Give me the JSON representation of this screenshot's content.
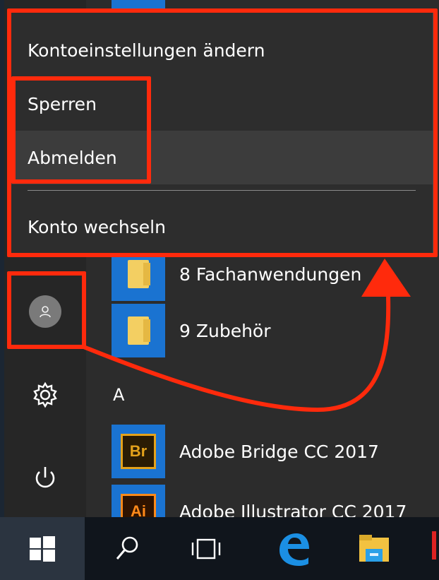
{
  "account_menu": {
    "items": [
      {
        "label": "Kontoeinstellungen ändern"
      },
      {
        "label": "Sperren"
      },
      {
        "label": "Abmelden"
      },
      {
        "label": "Konto wechseln"
      }
    ]
  },
  "app_list": {
    "items": [
      {
        "label": "8 Fachanwendungen",
        "icon": "folder-icon"
      },
      {
        "label": "9 Zubehör",
        "icon": "folder-icon"
      }
    ],
    "section_letter": "A",
    "adobe_items": [
      {
        "label": "Adobe Bridge CC 2017",
        "badge": "Br"
      },
      {
        "label": "Adobe Illustrator CC 2017",
        "badge": "Ai"
      }
    ]
  },
  "left_rail": {
    "user_icon": "user-avatar-icon",
    "settings_icon": "gear-icon",
    "power_icon": "power-icon"
  },
  "taskbar": {
    "start_icon": "windows-logo-icon",
    "search_icon": "search-icon",
    "task_view_icon": "task-view-icon",
    "edge_icon": "edge-browser-icon",
    "explorer_icon": "file-explorer-icon"
  },
  "colors": {
    "annotation_red": "#ff2a0c",
    "tile_blue": "#1a73d1",
    "menu_bg": "#2d2d2d",
    "taskbar_bg": "#10151c"
  }
}
